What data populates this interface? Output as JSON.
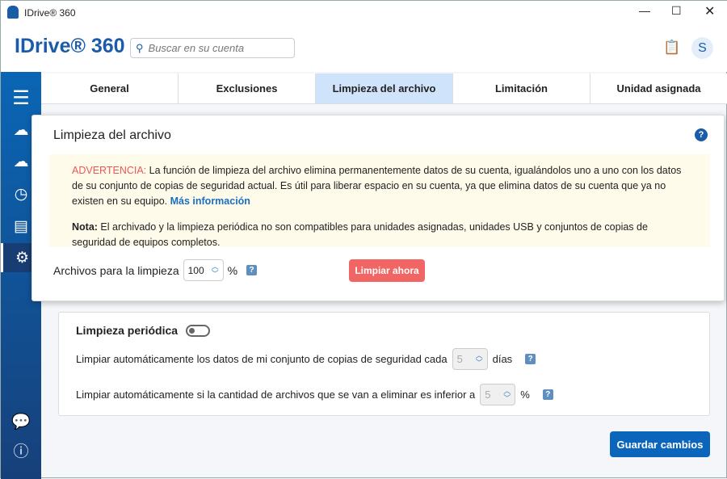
{
  "window": {
    "title": "IDrive® 360"
  },
  "header": {
    "logo": "IDrive® 360",
    "search_placeholder": "Buscar en su cuenta",
    "user_initial": "S"
  },
  "tabs": [
    "General",
    "Exclusiones",
    "Limpieza del archivo",
    "Limitación",
    "Unidad asignada"
  ],
  "modal": {
    "title": "Limpieza del archivo",
    "warning_label": "ADVERTENCIA:",
    "warning_text": " La función de limpieza del archivo elimina permanentemente datos de su cuenta, igualándolos uno a uno con los datos de su conjunto de copias de seguridad actual. Es útil para liberar espacio en su cuenta, ya que elimina datos de su cuenta que ya no existen en su equipo. ",
    "more_info": "Más información",
    "note_label": "Nota:",
    "note_text": "  El archivado y la limpieza periódica no son compatibles para unidades asignadas, unidades USB y conjuntos de copias de seguridad de equipos completos.",
    "files_label": "Archivos para la limpieza",
    "files_value": "100",
    "percent": "%",
    "clean_now": "Limpiar ahora"
  },
  "periodic": {
    "title": "Limpieza periódica",
    "enabled": false,
    "row1_label": "Limpiar automáticamente los datos de mi conjunto de copias de seguridad cada",
    "row1_value": "5",
    "row1_unit": "días",
    "row2_label": "Limpiar automáticamente si la cantidad de archivos que se van a eliminar es inferior a",
    "row2_value": "5",
    "row2_unit": "%"
  },
  "save": "Guardar cambios",
  "help": "?"
}
